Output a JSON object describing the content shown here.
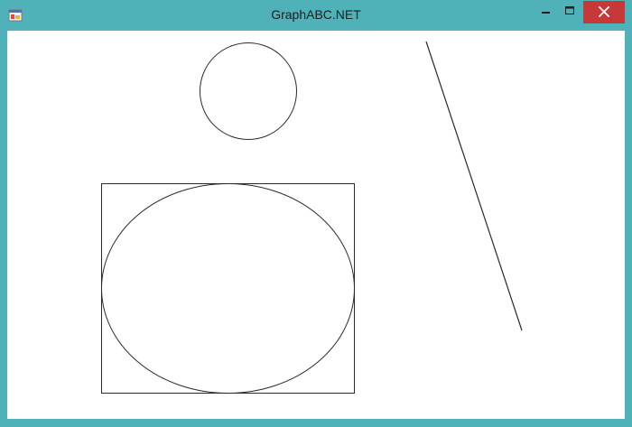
{
  "window": {
    "title": "GraphABC.NET",
    "accent_color": "#4fb2b8",
    "close_button_color": "#c7383a"
  },
  "titlebar": {
    "app_icon": "graphabc-app-icon",
    "minimize_icon": "minimize-icon",
    "maximize_icon": "maximize-icon",
    "close_icon": "close-icon"
  },
  "canvas": {
    "background": "#ffffff",
    "stroke_color": "#2a2a2a",
    "shapes": [
      "circle",
      "rectangle",
      "ellipse",
      "line"
    ]
  }
}
